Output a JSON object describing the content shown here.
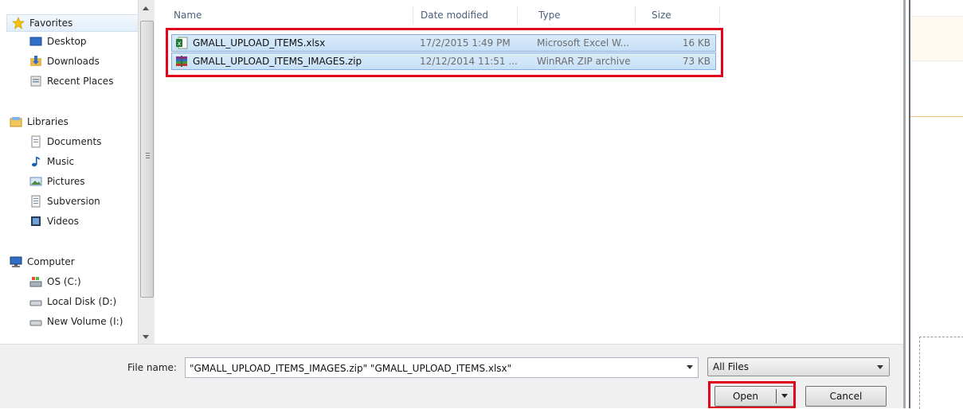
{
  "nav": {
    "favorites": "Favorites",
    "desktop": "Desktop",
    "downloads": "Downloads",
    "recent_places": "Recent Places",
    "libraries": "Libraries",
    "documents": "Documents",
    "music": "Music",
    "pictures": "Pictures",
    "subversion": "Subversion",
    "videos": "Videos",
    "computer": "Computer",
    "os_c": "OS (C:)",
    "local_disk_d": "Local Disk (D:)",
    "new_volume_i": "New Volume (I:)"
  },
  "columns": {
    "name": "Name",
    "date_modified": "Date modified",
    "type": "Type",
    "size": "Size"
  },
  "files": [
    {
      "name": "GMALL_UPLOAD_ITEMS.xlsx",
      "date": "17/2/2015 1:49 PM",
      "type": "Microsoft Excel W...",
      "size": "16 KB",
      "icon": "excel-icon"
    },
    {
      "name": "GMALL_UPLOAD_ITEMS_IMAGES.zip",
      "date": "12/12/2014 11:51 ...",
      "type": "WinRAR ZIP archive",
      "size": "73 KB",
      "icon": "winrar-icon"
    }
  ],
  "bottom": {
    "file_name_label": "File name:",
    "file_name_value": "\"GMALL_UPLOAD_ITEMS_IMAGES.zip\" \"GMALL_UPLOAD_ITEMS.xlsx\"",
    "file_type": "All Files",
    "open_label": "Open",
    "cancel_label": "Cancel"
  },
  "colors": {
    "highlight": "#e0001b",
    "selection": "#cce4f8",
    "selection_border": "#84acdd"
  }
}
